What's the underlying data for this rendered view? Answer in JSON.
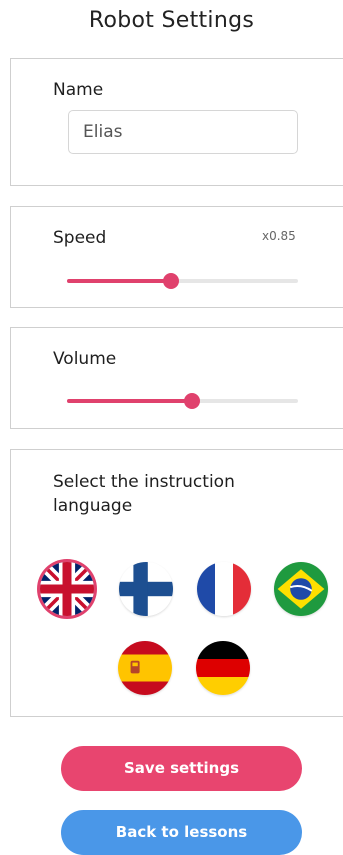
{
  "page": {
    "title": "Robot Settings"
  },
  "name_section": {
    "label": "Name",
    "value": "Elias"
  },
  "speed_section": {
    "label": "Speed",
    "multiplier": "x0.85",
    "level": 0.45
  },
  "volume_section": {
    "label": "Volume",
    "level": 0.54
  },
  "language_section": {
    "label": "Select the instruction language",
    "flags": [
      {
        "name": "uk-flag-icon",
        "selected": true
      },
      {
        "name": "finland-flag-icon",
        "selected": false
      },
      {
        "name": "france-flag-icon",
        "selected": false
      },
      {
        "name": "brazil-flag-icon",
        "selected": false
      },
      {
        "name": "spain-flag-icon",
        "selected": false
      },
      {
        "name": "germany-flag-icon",
        "selected": false
      }
    ]
  },
  "buttons": {
    "save": "Save settings",
    "back": "Back to lessons"
  },
  "colors": {
    "accent": "#e0416d",
    "save_button": "#e8456f",
    "back_button": "#4a97e8"
  }
}
